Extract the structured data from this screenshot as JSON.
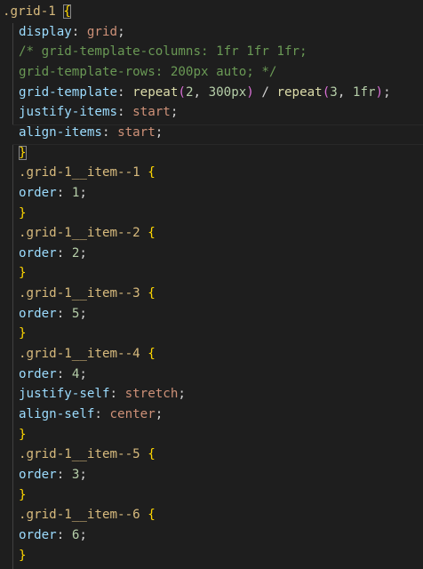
{
  "editor": {
    "language": "css",
    "lines": [
      [
        {
          "t": ".grid-1",
          "c": "sel"
        },
        {
          "t": " ",
          "c": "pun"
        },
        {
          "t": "{",
          "c": "br",
          "box": true
        }
      ],
      [
        {
          "t": "display",
          "c": "prop"
        },
        {
          "t": ": ",
          "c": "pun"
        },
        {
          "t": "grid",
          "c": "val"
        },
        {
          "t": ";",
          "c": "pun"
        }
      ],
      [
        {
          "t": "/* grid-template-columns: 1fr 1fr 1fr;",
          "c": "cmt"
        }
      ],
      [
        {
          "t": "grid-template-rows: 200px auto; */",
          "c": "cmt"
        }
      ],
      [
        {
          "t": "grid-template",
          "c": "prop"
        },
        {
          "t": ": ",
          "c": "pun"
        },
        {
          "t": "repeat",
          "c": "fn"
        },
        {
          "t": "(",
          "c": "br2"
        },
        {
          "t": "2",
          "c": "num"
        },
        {
          "t": ", ",
          "c": "pun"
        },
        {
          "t": "300px",
          "c": "num"
        },
        {
          "t": ")",
          "c": "br2"
        },
        {
          "t": " / ",
          "c": "pun"
        },
        {
          "t": "repeat",
          "c": "fn"
        },
        {
          "t": "(",
          "c": "br2"
        },
        {
          "t": "3",
          "c": "num"
        },
        {
          "t": ", ",
          "c": "pun"
        },
        {
          "t": "1fr",
          "c": "num"
        },
        {
          "t": ")",
          "c": "br2"
        },
        {
          "t": ";",
          "c": "pun"
        }
      ],
      [
        {
          "t": "justify-items",
          "c": "prop"
        },
        {
          "t": ": ",
          "c": "pun"
        },
        {
          "t": "start",
          "c": "val"
        },
        {
          "t": ";",
          "c": "pun"
        }
      ],
      [
        {
          "t": "align-items",
          "c": "prop"
        },
        {
          "t": ": ",
          "c": "pun"
        },
        {
          "t": "start",
          "c": "val"
        },
        {
          "t": ";",
          "c": "pun"
        }
      ],
      [
        {
          "t": "}",
          "c": "br",
          "box": true
        }
      ],
      [
        {
          "t": ".grid-1__item--1",
          "c": "sel"
        },
        {
          "t": " ",
          "c": "pun"
        },
        {
          "t": "{",
          "c": "br"
        }
      ],
      [
        {
          "t": "order",
          "c": "prop"
        },
        {
          "t": ": ",
          "c": "pun"
        },
        {
          "t": "1",
          "c": "num"
        },
        {
          "t": ";",
          "c": "pun"
        }
      ],
      [
        {
          "t": "}",
          "c": "br"
        }
      ],
      [
        {
          "t": ".grid-1__item--2",
          "c": "sel"
        },
        {
          "t": " ",
          "c": "pun"
        },
        {
          "t": "{",
          "c": "br"
        }
      ],
      [
        {
          "t": "order",
          "c": "prop"
        },
        {
          "t": ": ",
          "c": "pun"
        },
        {
          "t": "2",
          "c": "num"
        },
        {
          "t": ";",
          "c": "pun"
        }
      ],
      [
        {
          "t": "}",
          "c": "br"
        }
      ],
      [
        {
          "t": ".grid-1__item--3",
          "c": "sel"
        },
        {
          "t": " ",
          "c": "pun"
        },
        {
          "t": "{",
          "c": "br"
        }
      ],
      [
        {
          "t": "order",
          "c": "prop"
        },
        {
          "t": ": ",
          "c": "pun"
        },
        {
          "t": "5",
          "c": "num"
        },
        {
          "t": ";",
          "c": "pun"
        }
      ],
      [
        {
          "t": "}",
          "c": "br"
        }
      ],
      [
        {
          "t": ".grid-1__item--4",
          "c": "sel"
        },
        {
          "t": " ",
          "c": "pun"
        },
        {
          "t": "{",
          "c": "br"
        }
      ],
      [
        {
          "t": "order",
          "c": "prop"
        },
        {
          "t": ": ",
          "c": "pun"
        },
        {
          "t": "4",
          "c": "num"
        },
        {
          "t": ";",
          "c": "pun"
        }
      ],
      [
        {
          "t": "justify-self",
          "c": "prop"
        },
        {
          "t": ": ",
          "c": "pun"
        },
        {
          "t": "stretch",
          "c": "val"
        },
        {
          "t": ";",
          "c": "pun"
        }
      ],
      [
        {
          "t": "align-self",
          "c": "prop"
        },
        {
          "t": ": ",
          "c": "pun"
        },
        {
          "t": "center",
          "c": "val"
        },
        {
          "t": ";",
          "c": "pun"
        }
      ],
      [
        {
          "t": "}",
          "c": "br"
        }
      ],
      [
        {
          "t": ".grid-1__item--5",
          "c": "sel"
        },
        {
          "t": " ",
          "c": "pun"
        },
        {
          "t": "{",
          "c": "br"
        }
      ],
      [
        {
          "t": "order",
          "c": "prop"
        },
        {
          "t": ": ",
          "c": "pun"
        },
        {
          "t": "3",
          "c": "num"
        },
        {
          "t": ";",
          "c": "pun"
        }
      ],
      [
        {
          "t": "}",
          "c": "br"
        }
      ],
      [
        {
          "t": ".grid-1__item--6",
          "c": "sel"
        },
        {
          "t": " ",
          "c": "pun"
        },
        {
          "t": "{",
          "c": "br"
        }
      ],
      [
        {
          "t": "order",
          "c": "prop"
        },
        {
          "t": ": ",
          "c": "pun"
        },
        {
          "t": "6",
          "c": "num"
        },
        {
          "t": ";",
          "c": "pun"
        }
      ],
      [
        {
          "t": "}",
          "c": "br"
        }
      ]
    ],
    "colors": {
      "background": "#1e1e1e",
      "selector": "#d7ba7d",
      "property": "#9cdcfe",
      "value": "#ce9178",
      "number": "#b5cea8",
      "function": "#dcdcaa",
      "comment": "#6a9955",
      "bracket": "#ffd700",
      "paren": "#da70d6"
    }
  }
}
